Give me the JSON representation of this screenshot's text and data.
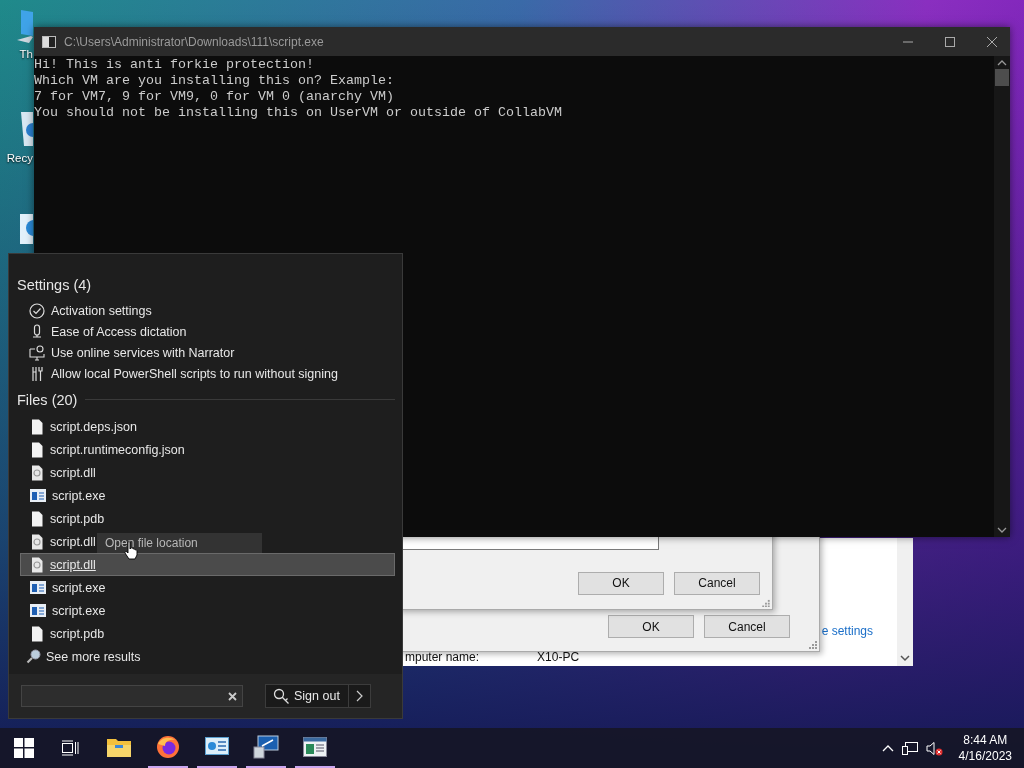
{
  "desktop_icons": [
    {
      "kind": "computer",
      "label": "Th"
    },
    {
      "kind": "recycle-bin",
      "label": "Recy"
    },
    {
      "kind": "app"
    }
  ],
  "system_window": {
    "link": "e settings",
    "name_label": "mputer name:",
    "name_value": "X10-PC"
  },
  "dialog_back": {
    "buttons": [
      "OK",
      "Cancel"
    ]
  },
  "dialog_front": {
    "buttons": [
      "OK",
      "Cancel"
    ]
  },
  "console": {
    "title": "C:\\Users\\Administrator\\Downloads\\111\\script.exe",
    "lines": [
      "Hi! This is anti forkie protection!",
      "Which VM are you installing this on? Example:",
      "7 for VM7, 9 for VM9, 0 for VM 0 (anarchy VM)",
      "You should not be installing this on UserVM or outside of CollabVM"
    ]
  },
  "start_menu": {
    "settings_heading": "Settings (4)",
    "settings": [
      {
        "kind": "check",
        "label": "Activation settings"
      },
      {
        "kind": "mic",
        "label": "Ease of Access dictation"
      },
      {
        "kind": "narrator",
        "label": "Use online services with Narrator"
      },
      {
        "kind": "tools",
        "label": "Allow local PowerShell scripts to run without signing"
      }
    ],
    "files_heading": "Files (20)",
    "files": [
      {
        "kind": "doc",
        "name": "script.deps.json",
        "selected": false
      },
      {
        "kind": "doc",
        "name": "script.runtimeconfig.json",
        "selected": false
      },
      {
        "kind": "dll",
        "name": "script.dll",
        "selected": false
      },
      {
        "kind": "exe",
        "name": "script.exe",
        "selected": false
      },
      {
        "kind": "doc",
        "name": "script.pdb",
        "selected": false
      },
      {
        "kind": "dll",
        "name": "script.dll",
        "selected": false
      },
      {
        "kind": "dll",
        "name": "script.dll",
        "selected": true
      },
      {
        "kind": "exe",
        "name": "script.exe",
        "selected": false
      },
      {
        "kind": "exe",
        "name": "script.exe",
        "selected": false
      },
      {
        "kind": "doc",
        "name": "script.pdb",
        "selected": false
      }
    ],
    "tooltip": "Open file location",
    "see_more": "See more results",
    "sign_out": "Sign out"
  },
  "taskbar": {
    "apps": [
      {
        "kind": "explorer",
        "running": false
      },
      {
        "kind": "firefox",
        "running": true
      },
      {
        "kind": "control-panel",
        "running": true
      },
      {
        "kind": "system",
        "running": true
      },
      {
        "kind": "window",
        "running": true
      }
    ],
    "time": "8:44 AM",
    "date": "4/16/2023"
  }
}
